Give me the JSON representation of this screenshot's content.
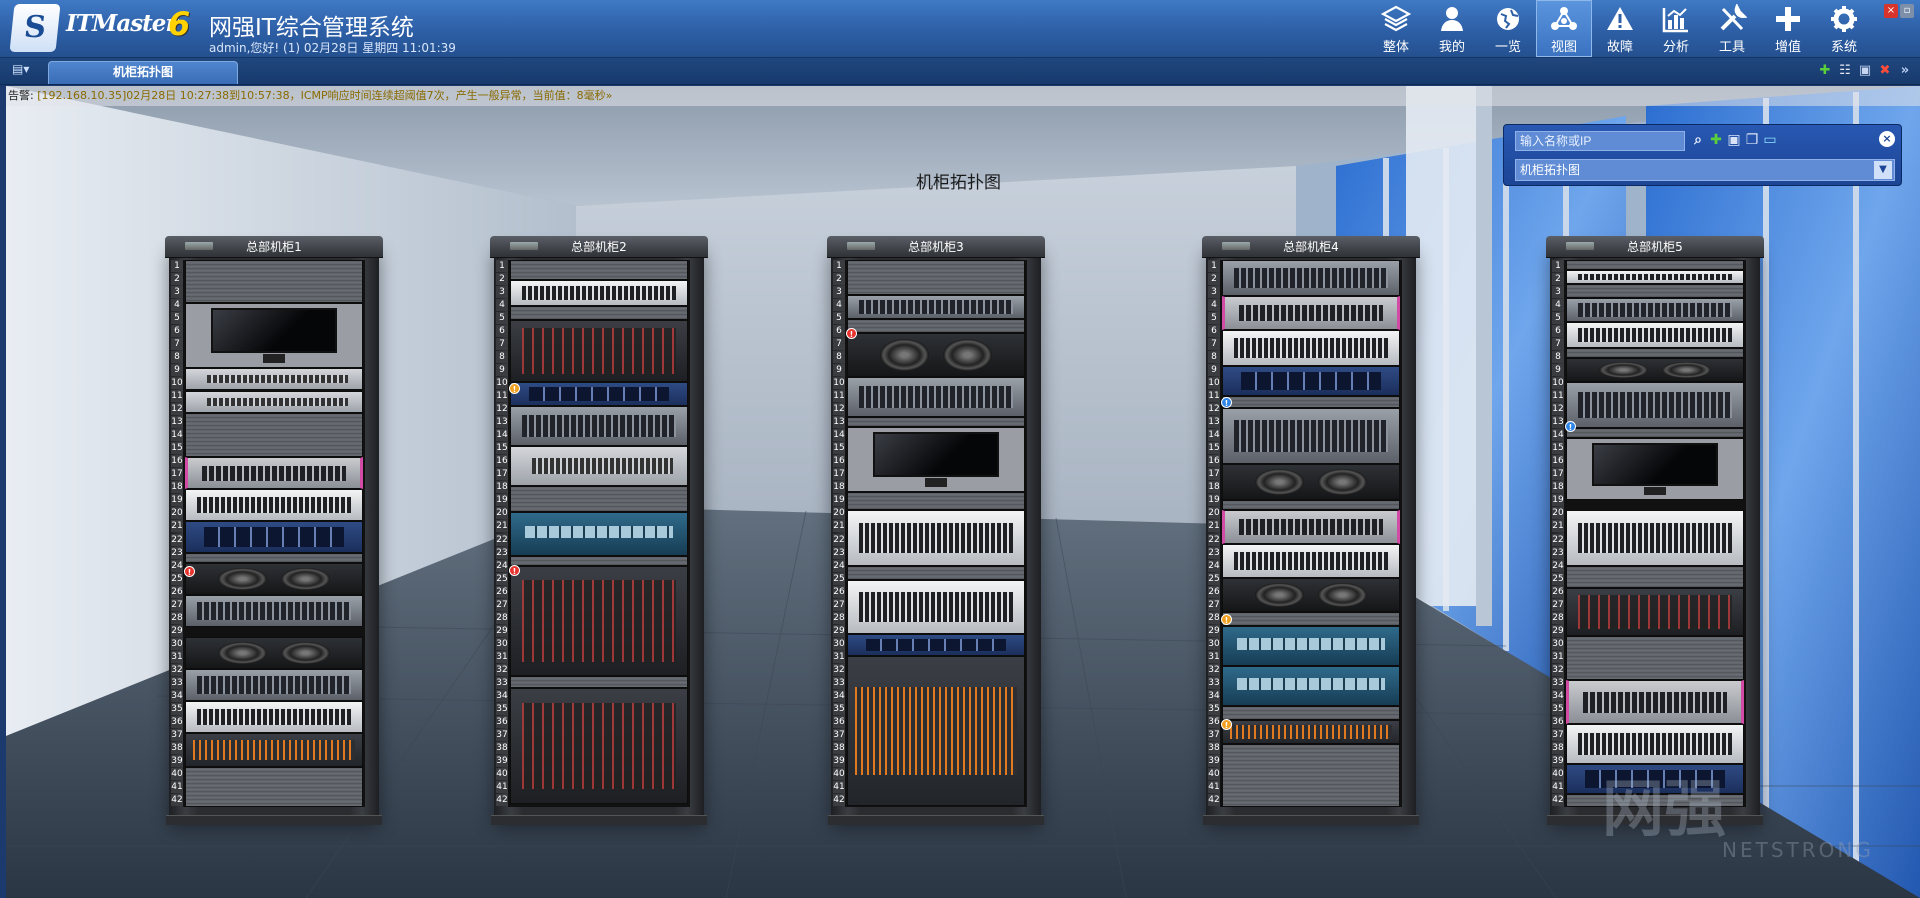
{
  "header": {
    "brand_name": "ITMaster",
    "brand_version": "6",
    "system_title": "网强IT综合管理系统",
    "user_line": "admin,您好! (1) 02月28日 星期四 11:01:39",
    "nav": [
      {
        "label": "整体",
        "icon": "layers-icon"
      },
      {
        "label": "我的",
        "icon": "user-icon"
      },
      {
        "label": "一览",
        "icon": "globe-icon"
      },
      {
        "label": "视图",
        "icon": "topology-icon",
        "active": true
      },
      {
        "label": "故障",
        "icon": "warning-icon"
      },
      {
        "label": "分析",
        "icon": "chart-icon"
      },
      {
        "label": "工具",
        "icon": "tools-icon"
      },
      {
        "label": "增值",
        "icon": "plus-icon"
      },
      {
        "label": "系统",
        "icon": "gear-icon"
      }
    ]
  },
  "tab": {
    "label": "机柜拓扑图"
  },
  "alarm": {
    "label": "告警:",
    "message": "[192.168.10.35]02月28日 10:27:38到10:57:38，ICMP响应时间连续超阈值7次，产生一般异常，当前值：8毫秒»"
  },
  "topology": {
    "title": "机柜拓扑图"
  },
  "search_panel": {
    "search_placeholder": "输入名称或IP",
    "view_select_value": "机柜拓扑图"
  },
  "racks": [
    {
      "name": "总部机柜1",
      "units": 42
    },
    {
      "name": "总部机柜2",
      "units": 42
    },
    {
      "name": "总部机柜3",
      "units": 42
    },
    {
      "name": "总部机柜4",
      "units": 42
    },
    {
      "name": "总部机柜5",
      "units": 42
    }
  ],
  "watermark": {
    "logo": "网强",
    "brand": "NETSTRONG"
  },
  "colors": {
    "header_blue": "#2d5fa6",
    "panel_blue": "#1c4595",
    "alarm_red": "#e8332e",
    "alarm_orange": "#f0a020",
    "alarm_blue": "#2f86e8"
  }
}
